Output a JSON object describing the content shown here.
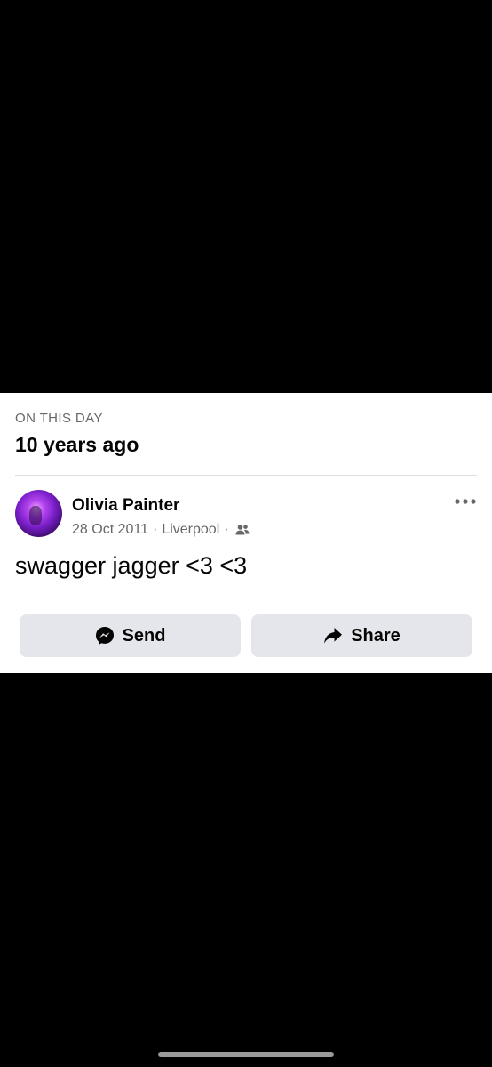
{
  "memory": {
    "eyebrow": "ON THIS DAY",
    "heading": "10 years ago"
  },
  "post": {
    "author": "Olivia Painter",
    "date": "28 Oct 2011",
    "separator": "·",
    "location": "Liverpool",
    "audience_icon": "friends-icon",
    "text": "swagger jagger <3 <3",
    "more_icon": "more-options-icon"
  },
  "actions": {
    "send_label": "Send",
    "send_icon": "messenger-icon",
    "share_label": "Share",
    "share_icon": "share-arrow-icon"
  },
  "colors": {
    "background": "#000000",
    "card": "#ffffff",
    "button": "#e4e6eb",
    "secondary_text": "#65676b"
  }
}
